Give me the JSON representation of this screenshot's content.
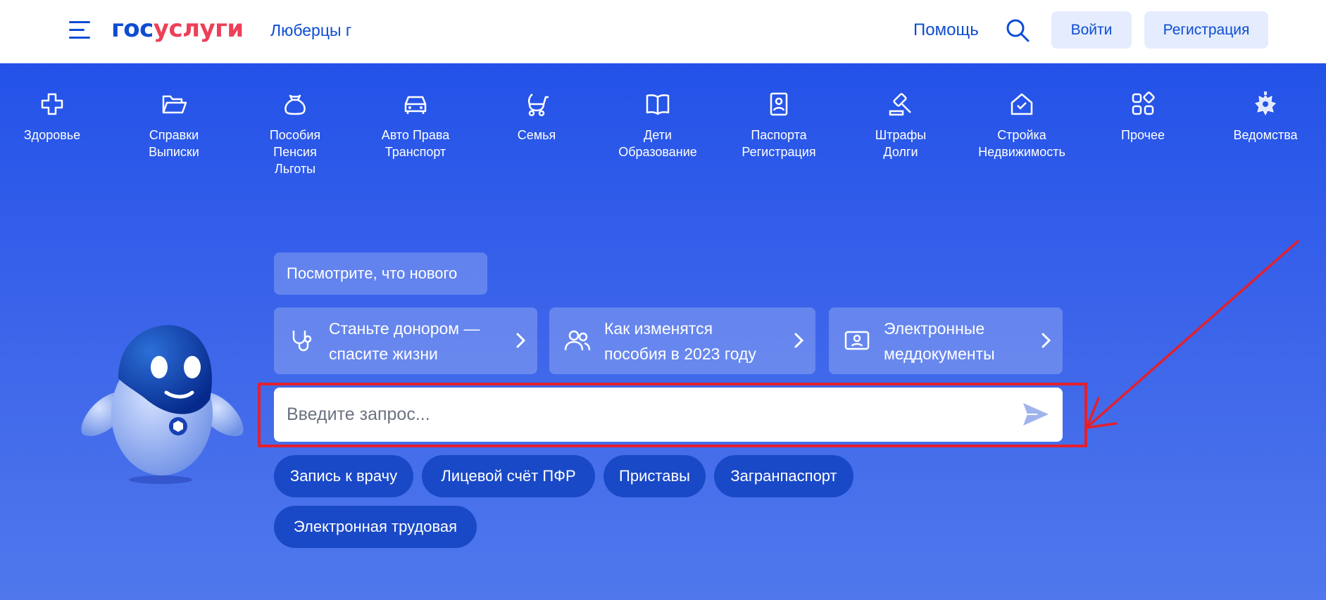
{
  "header": {
    "logo_part1": "гос",
    "logo_part2": "услуги",
    "city": "Люберцы г",
    "help": "Помощь",
    "login_label": "Войти",
    "register_label": "Регистрация"
  },
  "categories": [
    {
      "label": "Здоровье",
      "icon": "health-cross-icon"
    },
    {
      "label": "Справки\nВыписки",
      "icon": "folder-icon"
    },
    {
      "label": "Пособия\nПенсия\nЛьготы",
      "icon": "money-bag-icon"
    },
    {
      "label": "Авто Права\nТранспорт",
      "icon": "car-icon"
    },
    {
      "label": "Семья",
      "icon": "stroller-icon"
    },
    {
      "label": "Дети\nОбразование",
      "icon": "book-icon"
    },
    {
      "label": "Паспорта\nРегистрация",
      "icon": "passport-icon"
    },
    {
      "label": "Штрафы\nДолги",
      "icon": "gavel-icon"
    },
    {
      "label": "Стройка\nНедвижимость",
      "icon": "house-icon"
    },
    {
      "label": "Прочее",
      "icon": "grid-icon"
    },
    {
      "label": "Ведомства",
      "icon": "coat-of-arms-icon"
    }
  ],
  "news_pill": "Посмотрите, что нового",
  "cards": [
    {
      "text": "Станьте донором —\nспасите жизни",
      "icon": "stethoscope-icon"
    },
    {
      "text": "Как изменятся\nпособия в 2023 году",
      "icon": "people-icon"
    },
    {
      "text": "Электронные\nмеддокументы",
      "icon": "id-card-icon"
    }
  ],
  "search": {
    "placeholder": "Введите запрос..."
  },
  "chips": [
    "Запись к врачу",
    "Лицевой счёт ПФР",
    "Приставы",
    "Загранпаспорт",
    "Электронная трудовая"
  ],
  "colors": {
    "brand_blue": "#0d4cd3",
    "brand_red": "#ee3f58",
    "hero_bg": "#2352e8",
    "chip_bg": "#1949c7",
    "annotation_red": "#e3202d"
  }
}
